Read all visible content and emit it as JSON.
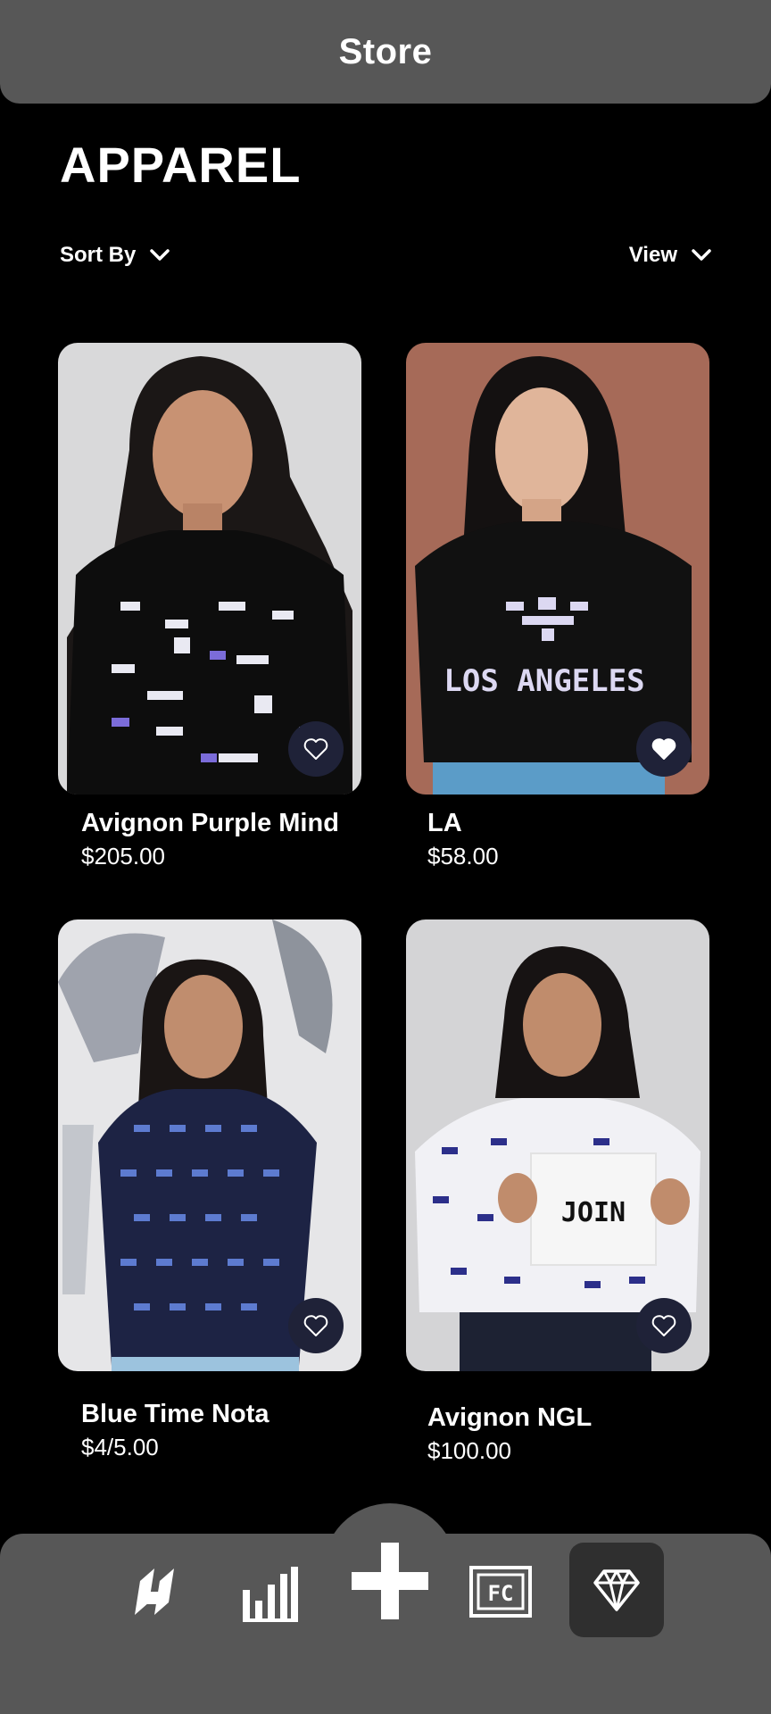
{
  "header": {
    "title": "Store"
  },
  "page": {
    "title": "APPAREL"
  },
  "controls": {
    "sort_label": "Sort By",
    "view_label": "View"
  },
  "products": [
    {
      "name": "Avignon Purple Mind",
      "price": "$205.00",
      "favorited": false
    },
    {
      "name": "LA",
      "price": "$58.00",
      "favorited": true,
      "shirt_print": "LOS ANGELES"
    },
    {
      "name": "Blue Time Nota",
      "price": "$4/5.00",
      "favorited": false
    },
    {
      "name": "Avignon NGL",
      "price": "$100.00",
      "favorited": false,
      "sign_text": "JOIN"
    }
  ],
  "bottom_nav": {
    "items": [
      {
        "icon": "brand-logo-icon"
      },
      {
        "icon": "bar-chart-icon"
      },
      {
        "icon": "plus-icon"
      },
      {
        "icon": "fc-badge-icon",
        "label": "FC"
      },
      {
        "icon": "diamond-icon",
        "active": true
      }
    ]
  },
  "colors": {
    "background": "#000000",
    "bar": "#575757",
    "fav_button": "#1f2238",
    "accent_purple": "#7b6cd9"
  }
}
